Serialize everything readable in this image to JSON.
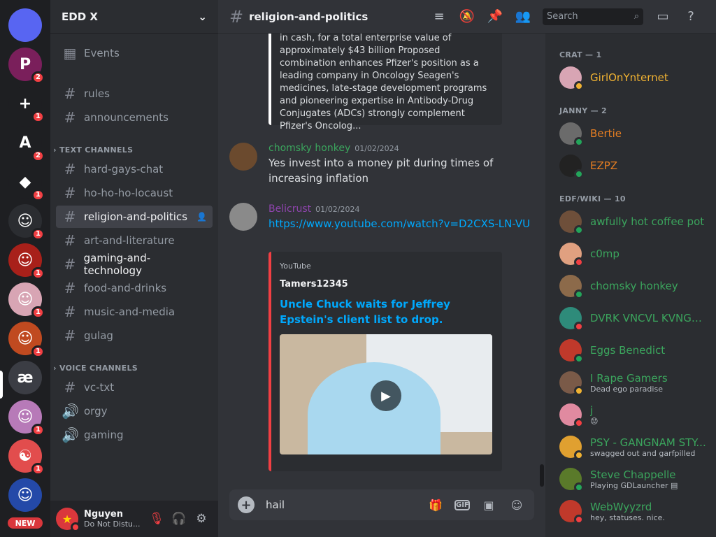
{
  "rail": {
    "servers": [
      {
        "name": "discord-home-icon",
        "label": "",
        "badge": "",
        "color": "#5865f2"
      },
      {
        "name": "server-p",
        "label": "P",
        "badge": "2",
        "color": "#7a1f5b"
      },
      {
        "name": "server-plus-circle",
        "label": "+",
        "badge": "1",
        "color": "#1e1f22"
      },
      {
        "name": "server-a-logo",
        "label": "A",
        "badge": "2",
        "color": "#1e1f22"
      },
      {
        "name": "server-arrow-logo",
        "label": "◆",
        "badge": "1",
        "color": "#1e1f22"
      },
      {
        "name": "server-hat-avatar",
        "label": "☺",
        "badge": "1",
        "color": "#2b2d31"
      },
      {
        "name": "server-luffy-avatar",
        "label": "☺",
        "badge": "1",
        "color": "#a8201a"
      },
      {
        "name": "server-pink-avatar",
        "label": "☺",
        "badge": "1",
        "color": "#d8a5b4"
      },
      {
        "name": "server-mask-avatar",
        "label": "☺",
        "badge": "1",
        "color": "#c04a20"
      },
      {
        "name": "server-ae",
        "label": "æ",
        "badge": "",
        "color": "#3b3d44"
      },
      {
        "name": "server-anime-avatar",
        "label": "☺",
        "badge": "1",
        "color": "#b77ab8"
      },
      {
        "name": "server-yin-yang",
        "label": "☯",
        "badge": "1",
        "color": "#e24d4d"
      },
      {
        "name": "server-blue-avatar",
        "label": "☺",
        "badge": "",
        "color": "#2449a8"
      }
    ],
    "new_label": "NEW"
  },
  "guild": {
    "name": "EDD X",
    "events_label": "Events",
    "channels_top": [
      "rules",
      "announcements"
    ],
    "text_category": "TEXT CHANNELS",
    "text_channels": [
      "hard-gays-chat",
      "ho-ho-ho-locaust",
      "religion-and-politics",
      "art-and-literature",
      "gaming-and-technology",
      "food-and-drinks",
      "music-and-media",
      "gulag"
    ],
    "voice_category": "VOICE CHANNELS",
    "voice_channels": [
      "vc-txt",
      "orgy",
      "gaming"
    ]
  },
  "user": {
    "name": "Nguyen",
    "status": "Do Not Distu..."
  },
  "topbar": {
    "channel": "religion-and-politics",
    "search_placeholder": "Search"
  },
  "messages": {
    "embed_text": "in cash, for a total enterprise value of approximately $43 billion Proposed combination enhances Pfizer's position as a leading company in Oncology Seagen's medicines, late-stage development programs and pioneering expertise in Antibody-Drug Conjugates (ADCs) strongly complement Pfizer's Oncolog...",
    "m1": {
      "author": "chomsky honkey",
      "time": "01/02/2024",
      "text": "Yes invest into a money pit during times of increasing inflation",
      "color": "#3ba55d"
    },
    "m2": {
      "author": "Belicrust",
      "time": "01/02/2024",
      "link": "https://www.youtube.com/watch?v=D2CXS-LN-VU",
      "color": "#8e44ad"
    },
    "yt": {
      "provider": "YouTube",
      "author": "Tamers12345",
      "title": "Uncle Chuck waits for Jeffrey Epstein's client list to drop."
    }
  },
  "composer": {
    "text": "hail"
  },
  "members": {
    "groups": [
      {
        "title": "CRAT — 1",
        "items": [
          {
            "name": "GirlOnYnternet",
            "sub": "",
            "color": "#f0b232",
            "status": "#f0b232",
            "av": "#d8a5b4"
          }
        ]
      },
      {
        "title": "JANNY — 2",
        "items": [
          {
            "name": "Bertie",
            "sub": "",
            "color": "#e67e22",
            "status": "#23a55a",
            "av": "#6b6b6b"
          },
          {
            "name": "EZPZ",
            "sub": "",
            "color": "#e67e22",
            "status": "#23a55a",
            "av": "#222222"
          }
        ]
      },
      {
        "title": "EDF/WIKI — 10",
        "items": [
          {
            "name": "awfully hot coffee pot",
            "sub": "",
            "color": "#3ba55d",
            "status": "#23a55a",
            "av": "#6e4f3a"
          },
          {
            "name": "c0mp",
            "sub": "",
            "color": "#3ba55d",
            "status": "#f23f43",
            "av": "#e0a080"
          },
          {
            "name": "chomsky honkey",
            "sub": "",
            "color": "#3ba55d",
            "status": "#23a55a",
            "av": "#8c6a4a"
          },
          {
            "name": "DVRK VNCVL KVNGD...",
            "sub": "",
            "color": "#3ba55d",
            "status": "#f23f43",
            "av": "#2e8b7a"
          },
          {
            "name": "Eggs Benedict",
            "sub": "",
            "color": "#3ba55d",
            "status": "#23a55a",
            "av": "#c0392b"
          },
          {
            "name": "I Rape Gamers",
            "sub": "Dead ego paradise",
            "color": "#3ba55d",
            "status": "#f0b232",
            "av": "#7a5a48"
          },
          {
            "name": "j",
            "sub": "😟",
            "color": "#3ba55d",
            "status": "#f23f43",
            "av": "#e08aa0"
          },
          {
            "name": "PSY - GANGNAM STY...",
            "sub": "swagged out and garfpilled",
            "color": "#3ba55d",
            "status": "#f0b232",
            "av": "#e0a030"
          },
          {
            "name": "Steve Chappelle",
            "sub": "Playing GDLauncher ▤",
            "color": "#3ba55d",
            "status": "#23a55a",
            "av": "#5a7a2a"
          },
          {
            "name": "WebWyyzrd",
            "sub": "hey, statuses. nice.",
            "color": "#3ba55d",
            "status": "#f23f43",
            "av": "#c0392b"
          }
        ]
      }
    ]
  }
}
